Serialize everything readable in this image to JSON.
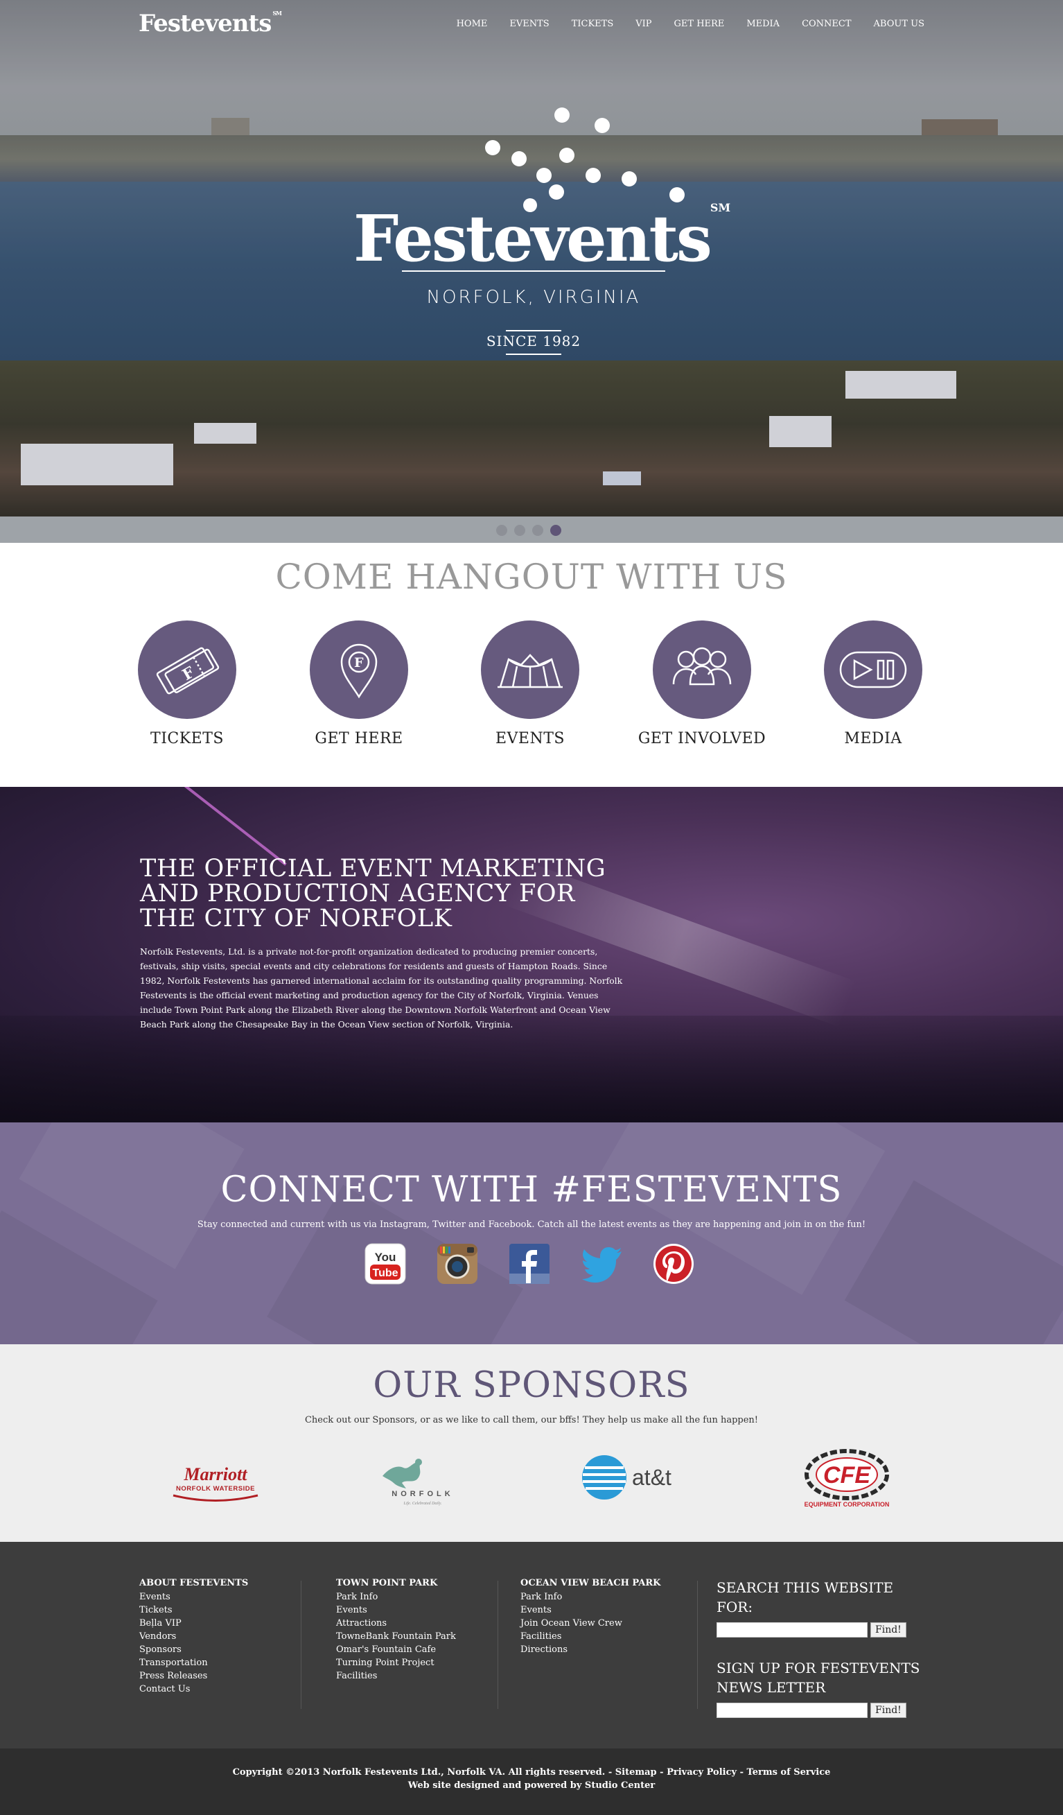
{
  "header": {
    "logo": "Festevents",
    "logo_mark": "SM",
    "nav": [
      "HOME",
      "EVENTS",
      "TICKETS",
      "VIP",
      "GET HERE",
      "MEDIA",
      "CONNECT",
      "ABOUT US"
    ]
  },
  "hero": {
    "title": "Festevents",
    "mark": "SM",
    "subtitle": "NORFOLK, VIRGINIA",
    "since": "SINCE 1982",
    "slide_count": 4,
    "active_slide": 4
  },
  "hangout": {
    "title": "COME HANGOUT WITH US",
    "items": [
      {
        "label": "TICKETS",
        "icon": "ticket-icon"
      },
      {
        "label": "GET HERE",
        "icon": "map-pin-icon"
      },
      {
        "label": "EVENTS",
        "icon": "pavilion-icon"
      },
      {
        "label": "GET INVOLVED",
        "icon": "people-icon"
      },
      {
        "label": "MEDIA",
        "icon": "play-pause-icon"
      }
    ]
  },
  "official": {
    "title": "THE OFFICIAL EVENT MARKETING AND PRODUCTION AGENCY FOR THE CITY OF NORFOLK",
    "body": "Norfolk Festevents, Ltd. is a private not-for-profit organization dedicated to producing premier concerts, festivals, ship visits, special events and city celebrations for residents and guests of Hampton Roads. Since 1982, Norfolk Festevents has garnered international acclaim for its outstanding quality programming. Norfolk Festevents is the official event marketing and production agency for the City of Norfolk, Virginia. Venues include Town Point Park along the Elizabeth River along the Downtown Norfolk Waterfront and Ocean View Beach Park along the Chesapeake Bay in the Ocean View section of Norfolk, Virginia."
  },
  "connect": {
    "title": "CONNECT WITH #FESTEVENTS",
    "text": "Stay connected and current with us via Instagram, Twitter and Facebook. Catch all the latest events as they are happening and join in on the fun!",
    "socials": [
      "youtube-icon",
      "instagram-icon",
      "facebook-icon",
      "twitter-icon",
      "pinterest-icon"
    ],
    "youtube_you": "You",
    "youtube_tube": "Tube"
  },
  "sponsors": {
    "title": "OUR SPONSORS",
    "text": "Check out our Sponsors, or as we like to call them, our bffs! They help us make all the fun happen!",
    "marriott": "Marriott",
    "marriott_sub": "NORFOLK WATERSIDE",
    "norfolk": "NORFOLK",
    "norfolk_sub": "Life. Celebrated Daily.",
    "att": "at&t",
    "cfe": "CFE",
    "cfe_sub": "EQUIPMENT CORPORATION",
    "brand_colors": {
      "marriott": "#b01f24",
      "att": "#2a9ad6",
      "cfe": "#c8202a",
      "norfolk": "#6fa79a"
    }
  },
  "footer": {
    "col1": {
      "title": "ABOUT FESTEVENTS",
      "links": [
        "Events",
        "Tickets",
        "Beḷla VIP",
        "Vendors",
        "Sponsors",
        "Transportation",
        "Press Releases",
        "Contact Us"
      ]
    },
    "col2": {
      "title": "TOWN POINT PARK",
      "links": [
        "Park Info",
        "Events",
        "Attractions",
        "TowneBank Fountain Park",
        "Omar's Fountain Cafe",
        "Turning Point Project",
        "Facilities"
      ]
    },
    "col3": {
      "title": "OCEAN VIEW BEACH PARK",
      "links": [
        "Park Info",
        "Events",
        "Join Ocean View Crew",
        "Facilities",
        "Directions"
      ]
    },
    "search_title": "SEARCH THIS WEBSITE FOR:",
    "search_button": "Find!",
    "newsletter_title": "SIGN UP FOR FESTEVENTS NEWS LETTER",
    "newsletter_button": "Find!"
  },
  "copyright": {
    "line1": "Copyright ©2013 Norfolk Festevents Ltd., Norfolk VA. All rights reserved.",
    "sitemap": "Sitemap",
    "privacy": "Privacy Policy",
    "terms": "Terms of Service",
    "line2": "Web site designed and powered by Studio Center"
  },
  "colors": {
    "accent_purple": "#665a7e",
    "connect_bg": "#7b6e95",
    "sponsors_title": "#5f5677",
    "footer_bg": "#3d3d3d"
  }
}
